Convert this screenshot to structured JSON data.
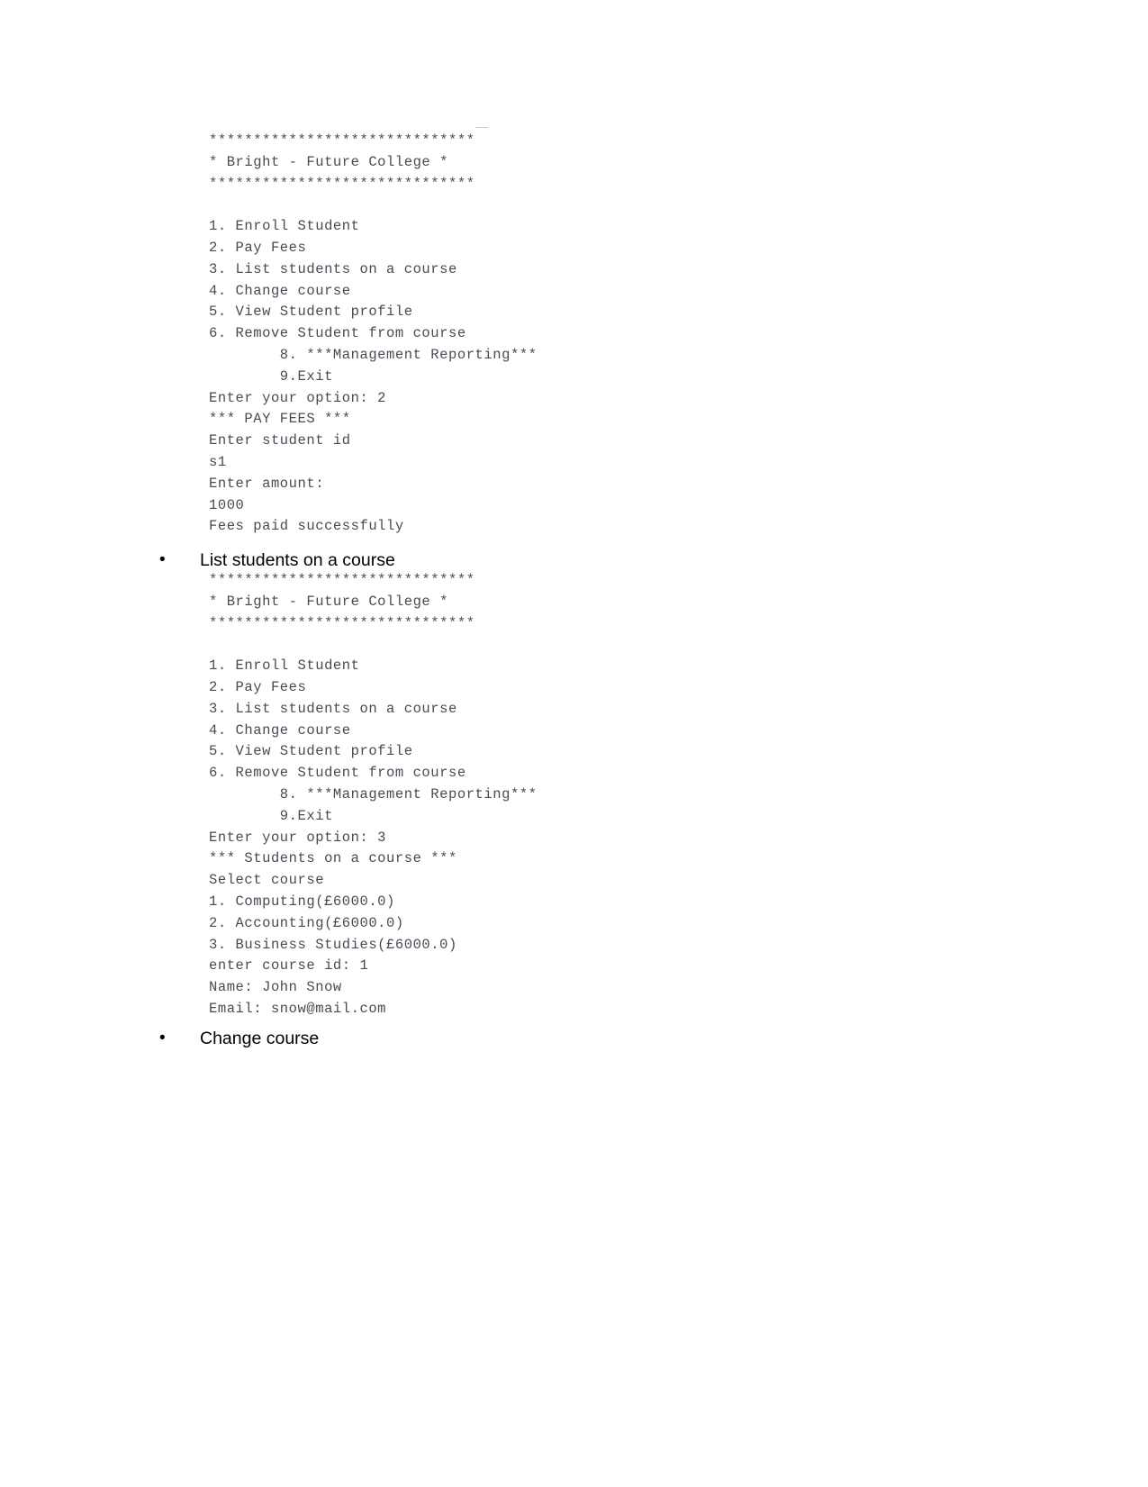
{
  "document": {
    "type": "word-processor-document-page",
    "background_color": "#ffffff",
    "console_text_color": "#4a4a55",
    "body_text_color": "#000000"
  },
  "console_block_1": {
    "name": "pay-fees-console-output",
    "lines": [
      "******************************",
      "* Bright - Future College *",
      "******************************",
      "",
      "1. Enroll Student",
      "2. Pay Fees",
      "3. List students on a course",
      "4. Change course",
      "5. View Student profile",
      "6. Remove Student from course",
      "        8. ***Management Reporting***",
      "        9.Exit",
      "Enter your option: 2",
      "*** PAY FEES ***",
      "Enter student id",
      "s1",
      "Enter amount:",
      "1000",
      "Fees paid successfully"
    ]
  },
  "bullet_1": {
    "marker": "•",
    "label": "List students on a course"
  },
  "console_block_2": {
    "name": "list-students-on-course-console-output",
    "lines": [
      "******************************",
      "* Bright - Future College *",
      "******************************",
      "",
      "1. Enroll Student",
      "2. Pay Fees",
      "3. List students on a course",
      "4. Change course",
      "5. View Student profile",
      "6. Remove Student from course",
      "        8. ***Management Reporting***",
      "        9.Exit",
      "Enter your option: 3",
      "*** Students on a course ***",
      "Select course",
      "1. Computing(£6000.0)",
      "2. Accounting(£6000.0)",
      "3. Business Studies(£6000.0)",
      "enter course id: 1",
      "Name: John Snow",
      "Email: snow@mail.com"
    ]
  },
  "bullet_2": {
    "marker": "•",
    "label": "Change course"
  }
}
